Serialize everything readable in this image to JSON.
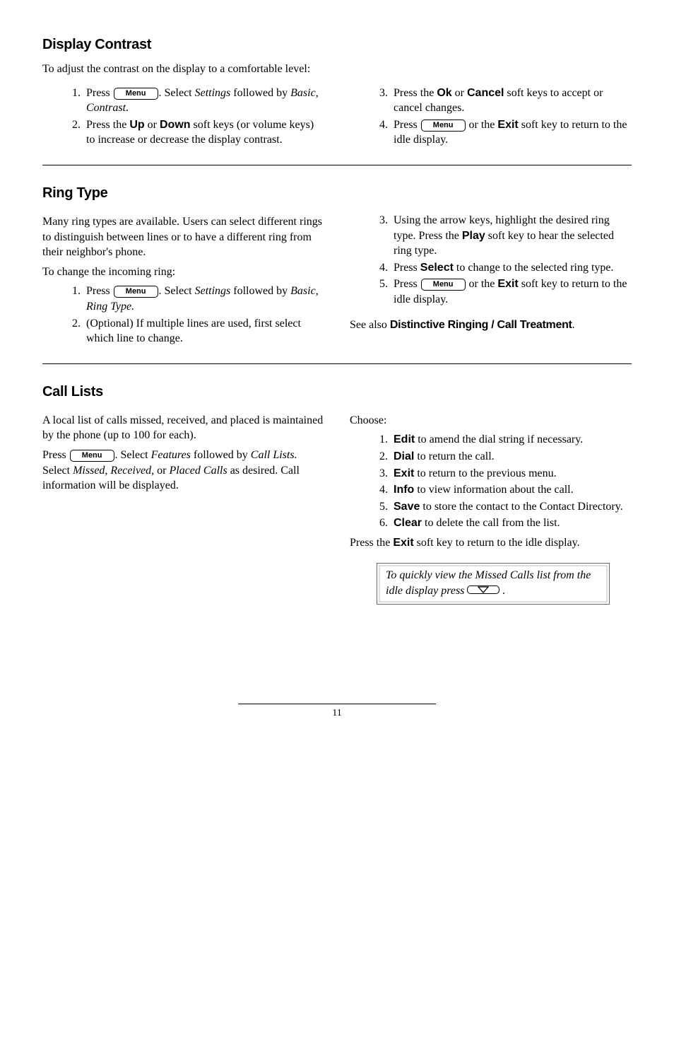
{
  "menu_label": "Menu",
  "s1": {
    "heading": "Display Contrast",
    "intro": "To adjust the contrast on the display to a comfortable level:",
    "left_li1_a": "Press ",
    "left_li1_b": ".  Select ",
    "left_li1_settings": "Settings",
    "left_li1_c": " followed by ",
    "left_li1_path": "Basic, Contrast",
    "left_li1_d": ".",
    "left_li2_a": "Press the ",
    "sk_up": "Up",
    "or": " or ",
    "sk_down": "Down",
    "left_li2_b": " soft keys (or volume keys) to increase or decrease the display contrast.",
    "right_li3_a": "Press the ",
    "sk_ok": "Ok",
    "sk_cancel": "Cancel",
    "right_li3_b": " soft keys to accept or cancel changes.",
    "right_li4_a": "Press ",
    "right_li4_b": " or the ",
    "sk_exit": "Exit",
    "right_li4_c": " soft key to return to the idle display."
  },
  "s2": {
    "heading": "Ring Type",
    "intro1": "Many ring types are available.  Users can select different rings to distinguish between lines or to have a different ring from their neighbor's phone.",
    "intro2": "To change the incoming ring:",
    "left_li1_a": "Press ",
    "left_li1_b": ".  Select ",
    "left_li1_settings": "Settings",
    "left_li1_c": " followed by ",
    "left_li1_path": "Basic, Ring Type.",
    "left_li2": "(Optional)  If multiple lines are used, first select which line to change.",
    "right_li3_a": "Using the arrow keys, highlight the desired ring type.  Press the ",
    "sk_play": "Play",
    "right_li3_b": " soft key to hear the selected ring type.",
    "right_li4_a": "Press ",
    "sk_select": "Select",
    "right_li4_b": " to change to the selected ring type.",
    "right_li5_a": "Press ",
    "right_li5_b": " or the ",
    "sk_exit": "Exit",
    "right_li5_c": " soft key to return to the idle display.",
    "seealso_a": "See also ",
    "seealso_b": "Distinctive Ringing / Call Treatment",
    "seealso_c": "."
  },
  "s3": {
    "heading": "Call Lists",
    "intro": "A local list of calls missed, received, and placed is maintained by the phone (up to 100 for each).",
    "p2_a": "Press ",
    "p2_b": ".  Select ",
    "p2_features": "Features",
    "p2_c": " followed by ",
    "p2_calllists": "Call Lists.",
    "p2_d": "  Select ",
    "p2_mrp": "Missed, Received,",
    "p2_e": " or ",
    "p2_placed": "Placed Calls",
    "p2_f": " as desired.  Call information will be displayed.",
    "choose": "Choose:",
    "li1_sk": "Edit",
    "li1": " to amend the dial string if necessary.",
    "li2_sk": "Dial",
    "li2": " to return the call.",
    "li3_sk": "Exit",
    "li3": " to return to the previous menu.",
    "li4_sk": "Info",
    "li4": " to view information about the call.",
    "li5_sk": "Save",
    "li5": " to store the contact to the Contact Directory.",
    "li6_sk": "Clear",
    "li6": " to delete the call from the list.",
    "press_exit_a": "Press the ",
    "press_exit_sk": "Exit",
    "press_exit_b": " soft key to return to the idle display.",
    "tip_a": "To quickly view the Missed Calls list from the idle display press ",
    "tip_b": " ."
  },
  "page_number": "11"
}
